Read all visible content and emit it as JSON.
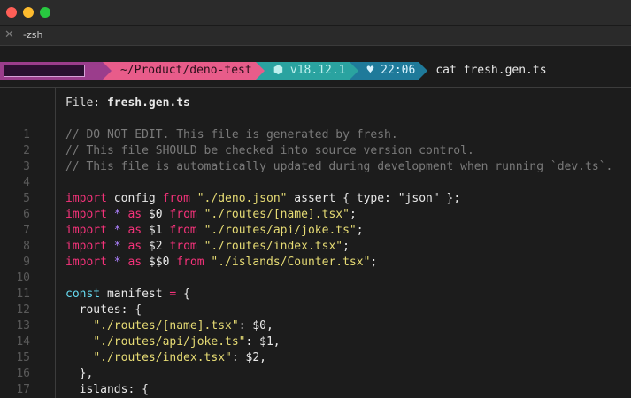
{
  "window": {
    "tab_title": "-zsh",
    "tab_close_glyph": "✕"
  },
  "prompt": {
    "path": "~/Product/deno-test",
    "node_version": "⬢ v18.12.1",
    "time": "♥ 22:06",
    "command": "cat fresh.gen.ts"
  },
  "file_header": {
    "label": "File: ",
    "filename": "fresh.gen.ts"
  },
  "code": {
    "lines": [
      {
        "n": "1",
        "tokens": [
          {
            "t": "// DO NOT EDIT. This file is generated by fresh.",
            "c": "comment"
          }
        ]
      },
      {
        "n": "2",
        "tokens": [
          {
            "t": "// This file SHOULD be checked into source version control.",
            "c": "comment"
          }
        ]
      },
      {
        "n": "3",
        "tokens": [
          {
            "t": "// This file is automatically updated during development when running `dev.ts`.",
            "c": "comment"
          }
        ]
      },
      {
        "n": "4",
        "tokens": []
      },
      {
        "n": "5",
        "tokens": [
          {
            "t": "import",
            "c": "kw"
          },
          {
            "t": " config ",
            "c": "def"
          },
          {
            "t": "from",
            "c": "kw"
          },
          {
            "t": " ",
            "c": "def"
          },
          {
            "t": "\"./deno.json\"",
            "c": "str"
          },
          {
            "t": " assert { type: ",
            "c": "def"
          },
          {
            "t": "\"json\"",
            "c": "def"
          },
          {
            "t": " };",
            "c": "def"
          }
        ]
      },
      {
        "n": "6",
        "tokens": [
          {
            "t": "import",
            "c": "kw"
          },
          {
            "t": " ",
            "c": "def"
          },
          {
            "t": "*",
            "c": "star"
          },
          {
            "t": " ",
            "c": "def"
          },
          {
            "t": "as",
            "c": "kw"
          },
          {
            "t": " $0 ",
            "c": "def"
          },
          {
            "t": "from",
            "c": "kw"
          },
          {
            "t": " ",
            "c": "def"
          },
          {
            "t": "\"./routes/[name].tsx\"",
            "c": "str"
          },
          {
            "t": ";",
            "c": "def"
          }
        ]
      },
      {
        "n": "7",
        "tokens": [
          {
            "t": "import",
            "c": "kw"
          },
          {
            "t": " ",
            "c": "def"
          },
          {
            "t": "*",
            "c": "star"
          },
          {
            "t": " ",
            "c": "def"
          },
          {
            "t": "as",
            "c": "kw"
          },
          {
            "t": " $1 ",
            "c": "def"
          },
          {
            "t": "from",
            "c": "kw"
          },
          {
            "t": " ",
            "c": "def"
          },
          {
            "t": "\"./routes/api/joke.ts\"",
            "c": "str"
          },
          {
            "t": ";",
            "c": "def"
          }
        ]
      },
      {
        "n": "8",
        "tokens": [
          {
            "t": "import",
            "c": "kw"
          },
          {
            "t": " ",
            "c": "def"
          },
          {
            "t": "*",
            "c": "star"
          },
          {
            "t": " ",
            "c": "def"
          },
          {
            "t": "as",
            "c": "kw"
          },
          {
            "t": " $2 ",
            "c": "def"
          },
          {
            "t": "from",
            "c": "kw"
          },
          {
            "t": " ",
            "c": "def"
          },
          {
            "t": "\"./routes/index.tsx\"",
            "c": "str"
          },
          {
            "t": ";",
            "c": "def"
          }
        ]
      },
      {
        "n": "9",
        "tokens": [
          {
            "t": "import",
            "c": "kw"
          },
          {
            "t": " ",
            "c": "def"
          },
          {
            "t": "*",
            "c": "star"
          },
          {
            "t": " ",
            "c": "def"
          },
          {
            "t": "as",
            "c": "kw"
          },
          {
            "t": " $$0 ",
            "c": "def"
          },
          {
            "t": "from",
            "c": "kw"
          },
          {
            "t": " ",
            "c": "def"
          },
          {
            "t": "\"./islands/Counter.tsx\"",
            "c": "str"
          },
          {
            "t": ";",
            "c": "def"
          }
        ]
      },
      {
        "n": "10",
        "tokens": []
      },
      {
        "n": "11",
        "tokens": [
          {
            "t": "const",
            "c": "fn"
          },
          {
            "t": " manifest ",
            "c": "def"
          },
          {
            "t": "=",
            "c": "op"
          },
          {
            "t": " {",
            "c": "def"
          }
        ]
      },
      {
        "n": "12",
        "tokens": [
          {
            "t": "  routes: {",
            "c": "def"
          }
        ]
      },
      {
        "n": "13",
        "tokens": [
          {
            "t": "    ",
            "c": "def"
          },
          {
            "t": "\"./routes/[name].tsx\"",
            "c": "str"
          },
          {
            "t": ": $0,",
            "c": "def"
          }
        ]
      },
      {
        "n": "14",
        "tokens": [
          {
            "t": "    ",
            "c": "def"
          },
          {
            "t": "\"./routes/api/joke.ts\"",
            "c": "str"
          },
          {
            "t": ": $1,",
            "c": "def"
          }
        ]
      },
      {
        "n": "15",
        "tokens": [
          {
            "t": "    ",
            "c": "def"
          },
          {
            "t": "\"./routes/index.tsx\"",
            "c": "str"
          },
          {
            "t": ": $2,",
            "c": "def"
          }
        ]
      },
      {
        "n": "16",
        "tokens": [
          {
            "t": "  },",
            "c": "def"
          }
        ]
      },
      {
        "n": "17",
        "tokens": [
          {
            "t": "  islands: {",
            "c": "def"
          }
        ]
      }
    ]
  },
  "colors": {
    "comment": "#7a7a7a",
    "keyword": "#f5327a",
    "string": "#e6db74",
    "number": "#ae81ff",
    "const": "#66d9ef"
  }
}
